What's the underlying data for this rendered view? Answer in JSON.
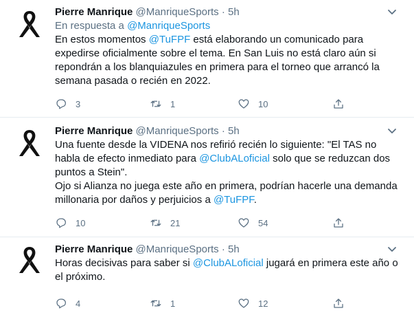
{
  "tweets": [
    {
      "name": "Pierre Manrique",
      "handle": "@ManriqueSports",
      "dot": "·",
      "time": "5h",
      "reply_prefix": "En respuesta a ",
      "reply_to": "@ManriqueSports",
      "text_parts": [
        "En estos momentos ",
        "@TuFPF",
        " está elaborando un comunicado para expedirse oficialmente sobre el tema. En San Luis no está claro aún si repondrán a los blanquiazules en primera para el torneo que arrancó la semana pasada o recién en 2022."
      ],
      "replies": "3",
      "retweets": "1",
      "likes": "10"
    },
    {
      "name": "Pierre Manrique",
      "handle": "@ManriqueSports",
      "dot": "·",
      "time": "5h",
      "text_parts": [
        "Una fuente desde la VIDENA nos refirió recién lo siguiente: \"El TAS no habla de efecto inmediato para ",
        "@ClubALoficial",
        " solo que se reduzcan dos puntos a Stein\".",
        "Ojo si Alianza no juega este año en primera, podrían hacerle una demanda millonaria por daños y perjuicios a ",
        "@TuFPF",
        "."
      ],
      "replies": "10",
      "retweets": "21",
      "likes": "54"
    },
    {
      "name": "Pierre Manrique",
      "handle": "@ManriqueSports",
      "dot": "·",
      "time": "5h",
      "text_parts": [
        "Horas decisivas para saber si ",
        "@ClubALoficial",
        " jugará en primera este año o el próximo."
      ],
      "replies": "4",
      "retweets": "1",
      "likes": "12"
    }
  ],
  "icons": {
    "avatar": "black-mourning-ribbon-icon",
    "more": "chevron-down-icon",
    "reply": "reply-icon",
    "retweet": "retweet-icon",
    "like": "heart-icon",
    "share": "share-icon"
  },
  "colors": {
    "text": "#0f1419",
    "secondary": "#5b7083",
    "mention": "#1b95e0",
    "divider": "#e6ecf0"
  }
}
